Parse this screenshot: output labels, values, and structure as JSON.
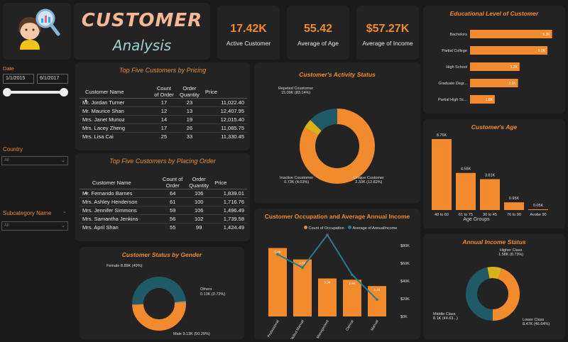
{
  "header": {
    "title": "CUSTOMER",
    "subtitle": "Analysis"
  },
  "kpis": [
    {
      "value": "17.42K",
      "label": "Active Customer"
    },
    {
      "value": "55.42",
      "label": "Average of Age"
    },
    {
      "value": "$57.27K",
      "label": "Average of Income"
    }
  ],
  "filters": {
    "date_label": "Date",
    "start_date": "1/1/2015",
    "end_date": "6/1/2017",
    "country_label": "Country",
    "country_value": "All",
    "subcategory_label": "Subcategory Name",
    "subcategory_value": "All"
  },
  "top_pricing": {
    "title": "Top Five Customers by Pricing",
    "columns": [
      "Customer Name",
      "Count of Order",
      "Order Quantity",
      "Price"
    ],
    "rows": [
      [
        "Mr. Jordan Turner",
        "17",
        "23",
        "11,022.40"
      ],
      [
        "Mr. Maurice Shan",
        "12",
        "13",
        "12,407.95"
      ],
      [
        "Mrs. Janet Munoz",
        "14",
        "19",
        "12,015.40"
      ],
      [
        "Mrs. Lacey Zheng",
        "17",
        "26",
        "11,085.75"
      ],
      [
        "Mrs. Lisa Cai",
        "25",
        "33",
        "11,330.45"
      ]
    ]
  },
  "top_orders": {
    "title": "Top Five Customers by Placing Order",
    "columns": [
      "Customer Name",
      "Count of Order",
      "Order Quantity",
      "Price"
    ],
    "rows": [
      [
        "Mr. Fernando Barnes",
        "64",
        "106",
        "1,839.01"
      ],
      [
        "Mrs. Ashley Henderson",
        "61",
        "100",
        "1,716.76"
      ],
      [
        "Mrs. Jennifer Simmons",
        "59",
        "106",
        "1,496.49"
      ],
      [
        "Mrs. Samantha Jenkins",
        "56",
        "102",
        "1,739.58"
      ],
      [
        "Mrs. April Shan",
        "55",
        "99",
        "1,424.49"
      ]
    ]
  },
  "activity_status": {
    "title": "Customer's Activity Status",
    "labels": [
      {
        "line1": "Repeted Coustomer",
        "line2": "15.09K (83.14%)"
      },
      {
        "line1": "Inactive Coustomer",
        "line2": "0.73K (4.03%)"
      },
      {
        "line1": "Unique Customer",
        "line2": "2.33K (12.82%)"
      }
    ],
    "colors": [
      "#f28a2e",
      "#d9b21a",
      "#1f5a66"
    ]
  },
  "education": {
    "title": "Educational Level of Customer",
    "colors": {
      "bar": "#f28a2e"
    }
  },
  "age": {
    "title": "Customer's Age",
    "xlabel": "Age Groups",
    "colors": {
      "bar": "#f28a2e"
    }
  },
  "occupation": {
    "title": "Customer Occupation and Average Annual Income",
    "legend": [
      "Count of Occupation",
      "Average of AnnualIncome"
    ],
    "colors": {
      "bar": "#f28a2e",
      "line": "#2d7a8a"
    }
  },
  "gender": {
    "title": "Customer Status by Gender",
    "labels": [
      {
        "line1": "Female 8.89K (49%)",
        "line2": ""
      },
      {
        "line1": "Others",
        "line2": "0.13K (0.72%)"
      },
      {
        "line1": "Male 9.13K (50.29%)",
        "line2": ""
      }
    ],
    "colors": [
      "#1f5a66",
      "#9a9a9a",
      "#f28a2e"
    ]
  },
  "income_status": {
    "title": "Annual Income Status",
    "labels": [
      {
        "line1": "Higher Class",
        "line2": "1.58K (8.73%)"
      },
      {
        "line1": "Middle Class",
        "line2": "8.1K (44.63...)"
      },
      {
        "line1": "Lower Class",
        "line2": "8.47K (46.64%)"
      }
    ],
    "colors": [
      "#d9b21a",
      "#f28a2e",
      "#1f5a66"
    ]
  },
  "chart_data": [
    {
      "type": "pie",
      "title": "Customer's Activity Status",
      "categories": [
        "Repeted Coustomer",
        "Inactive Coustomer",
        "Unique Customer"
      ],
      "values": [
        15.09,
        0.73,
        2.33
      ],
      "percent": [
        83.14,
        4.03,
        12.82
      ]
    },
    {
      "type": "bar",
      "title": "Educational Level of Customer",
      "orientation": "horizontal",
      "categories": [
        "Bachelors",
        "Partial College",
        "High School",
        "Graduate Degr...",
        "Partial High Sc..."
      ],
      "values": [
        5.3,
        5.0,
        3.2,
        3.1,
        1.6
      ],
      "data_labels": [
        "5.3K",
        "5.0K",
        "3.2K",
        "3.1K",
        "1.6K"
      ]
    },
    {
      "type": "bar",
      "title": "Customer's Age",
      "xlabel": "Age Groups",
      "categories": [
        "48 to 60",
        "61 to 75",
        "30 to 45",
        "76 to 90",
        "Avobe 90"
      ],
      "values": [
        8.76,
        4.58,
        3.81,
        0.95,
        0.05
      ],
      "data_labels": [
        "8.76K",
        "4.58K",
        "3.81K",
        "0.95K",
        "0.05K"
      ]
    },
    {
      "type": "bar",
      "title": "Customer Occupation and Average Annual Income",
      "categories": [
        "Professional",
        "Skilled Manual",
        "Management",
        "Clerical",
        "Manual"
      ],
      "series": [
        {
          "name": "Count of Occupation",
          "values": [
            5.4,
            4.5,
            3.0,
            2.9,
            2.4
          ],
          "data_labels": [
            "5.4K",
            "4.5K",
            "3.0K",
            "2.9K",
            "2.4K"
          ]
        },
        {
          "name": "Average of AnnualIncome",
          "type": "line",
          "values": [
            70000,
            55000,
            92000,
            47000,
            19000
          ]
        }
      ],
      "y2_ticks": [
        "$0K",
        "$20K",
        "$40K",
        "$60K",
        "$80K"
      ],
      "y2lim": [
        0,
        80000
      ]
    },
    {
      "type": "pie",
      "title": "Customer Status by Gender",
      "categories": [
        "Female",
        "Others",
        "Male"
      ],
      "values": [
        8.89,
        0.13,
        9.13
      ],
      "percent": [
        49,
        0.72,
        50.29
      ]
    },
    {
      "type": "pie",
      "title": "Annual Income Status",
      "categories": [
        "Higher Class",
        "Middle Class",
        "Lower Class"
      ],
      "values": [
        1.58,
        8.1,
        8.47
      ],
      "percent": [
        8.73,
        44.63,
        46.64
      ]
    }
  ]
}
